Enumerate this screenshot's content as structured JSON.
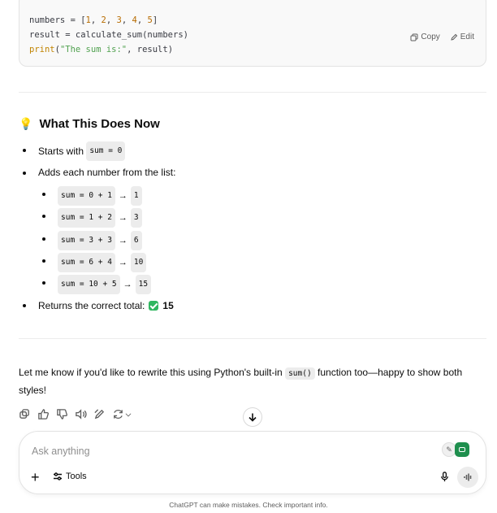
{
  "code": {
    "lines": {
      "l1_a": "numbers = [",
      "n1": "1",
      "c1": ", ",
      "n2": "2",
      "c2": ", ",
      "n3": "3",
      "c3": ", ",
      "n4": "4",
      "c4": ", ",
      "n5": "5",
      "l1_end": "]",
      "l2": "result = calculate_sum(numbers)",
      "l3_fn": "print",
      "l3_a": "(",
      "l3_str": "\"The sum is:\"",
      "l3_b": ", result)"
    },
    "copy_label": "Copy",
    "edit_label": "Edit"
  },
  "section": {
    "icon": "lightbulb-icon",
    "title": "What This Does Now"
  },
  "bullets": {
    "b1_text": "Starts with",
    "b1_code": "sum = 0",
    "b2_text": "Adds each number from the list:",
    "steps": [
      {
        "expr": "sum = 0 + 1",
        "arrow": "→",
        "result": "1"
      },
      {
        "expr": "sum = 1 + 2",
        "arrow": "→",
        "result": "3"
      },
      {
        "expr": "sum = 3 + 3",
        "arrow": "→",
        "result": "6"
      },
      {
        "expr": "sum = 6 + 4",
        "arrow": "→",
        "result": "10"
      },
      {
        "expr": "sum = 10 + 5",
        "arrow": "→",
        "result": "15"
      }
    ],
    "b3_text": "Returns the correct total:",
    "b3_value": "15"
  },
  "message": {
    "p_a": "Let me know if you'd like to rewrite this using Python's built-in",
    "p_code": "sum()",
    "p_b": "function too—happy to show both styles!"
  },
  "composer": {
    "placeholder": "Ask anything",
    "tools_label": "Tools"
  },
  "footer": "ChatGPT can make mistakes. Check important info.",
  "colors": {
    "accent_green": "#2fb65f",
    "text": "#0d0d0d"
  }
}
